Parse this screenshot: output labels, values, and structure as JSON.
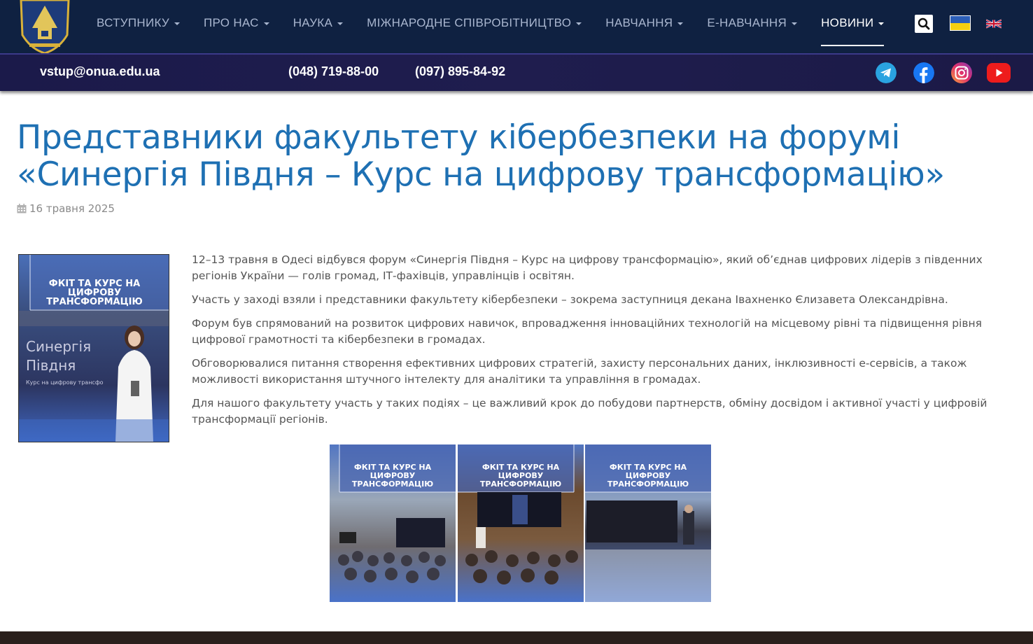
{
  "nav": {
    "items": [
      {
        "label": "ВСТУПНИКУ"
      },
      {
        "label": "ПРО НАС"
      },
      {
        "label": "НАУКА"
      },
      {
        "label": "МІЖНАРОДНЕ СПІВРОБІТНИЦТВО"
      },
      {
        "label": "НАВЧАННЯ"
      },
      {
        "label": "Е-НАВЧАННЯ"
      },
      {
        "label": "НОВИНИ"
      }
    ],
    "active_item": "НОВИНИ"
  },
  "contacts": {
    "email": "vstup@onua.edu.ua",
    "phone1": "(048) 719-88-00",
    "phone2": "(097) 895-84-92"
  },
  "social": [
    "telegram-icon",
    "facebook-icon",
    "instagram-icon",
    "youtube-icon"
  ],
  "article": {
    "title": "Представники факультету кібербезпеки на форумі «Синергія Півдня – Курс на цифрову трансформацію»",
    "date": "16 травня 2025",
    "paragraphs": [
      "12–13 травня в Одесі відбувся форум «Синергія Півдня – Курс на цифрову трансформацію», який об’єднав цифрових лідерів з південних регіонів України — голів громад, ІТ-фахівців, управлінців і освітян.",
      "Участь у заході взяли і представники факультету кібербезпеки – зокрема заступниця декана Івахненко Єлизавета Олександрівна.",
      "Форум був спрямований на розвиток цифрових навичок, впровадження інноваційних технологій на місцевому рівні та підвищення рівня цифрової грамотності та кібербезпеки в громадах.",
      "Обговорювалися питання створення ефективних цифрових стратегій, захисту персональних даних, інклюзивності е-сервісів, а також можливості використання штучного інтелекту для аналітики та управління в громадах.",
      "Для нашого факультету участь у таких подіях – це важливий крок до побудови партнерств, обміну досвідом і активної участі у цифровій трансформації регіонів."
    ],
    "photo_banner": "ФКІТ ТА КУРС НА ЦИФРОВУ ТРАНСФОРМАЦІЮ",
    "photo_sign_title": "Синергія Півдня",
    "photo_sign_sub": "Курс на цифрову трансфо"
  },
  "colors": {
    "nav_bg": "#0f2141",
    "contact_bg": "#1e1c4c",
    "title": "#1e70b3",
    "text": "#555555"
  }
}
